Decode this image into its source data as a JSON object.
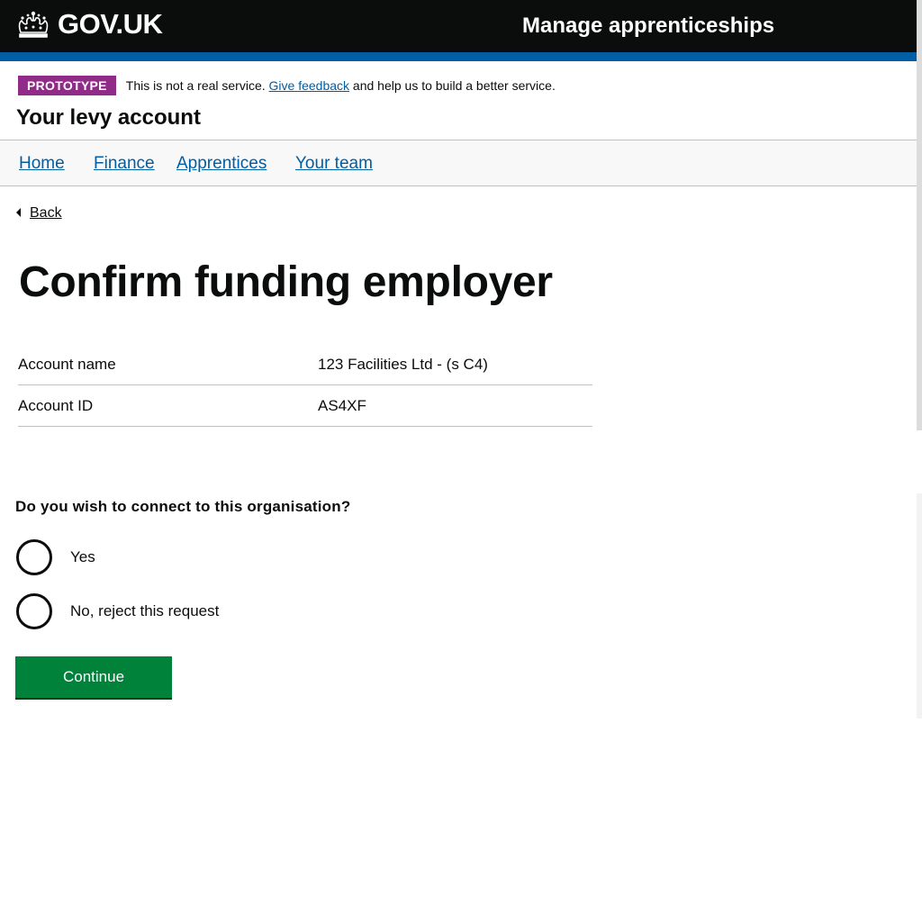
{
  "header": {
    "logo_text": "GOV.UK",
    "service_name": "Manage apprenticeships",
    "bg_color": "#0b0c0c",
    "bar_color": "#005ea5"
  },
  "phase_banner": {
    "tag": "PROTOTYPE",
    "text_before": "This is not a real service.",
    "link_text": "Give feedback",
    "text_after": "and help us to build a better service.",
    "tag_color": "#912b88"
  },
  "account_title": "Your levy account",
  "nav": {
    "items": [
      {
        "label": "Home"
      },
      {
        "label": "Finance"
      },
      {
        "label": "Apprentices"
      },
      {
        "label": "Your team"
      }
    ]
  },
  "back_link": "Back",
  "page_title": "Confirm funding employer",
  "summary": {
    "rows": [
      {
        "key": "Account name",
        "value": "123 Facilities Ltd - (s C4)"
      },
      {
        "key": "Account ID",
        "value": "AS4XF"
      }
    ]
  },
  "question": "Do you wish to connect to this organisation?",
  "options": [
    {
      "label": "Yes"
    },
    {
      "label": "No, reject this request"
    }
  ],
  "continue_button": "Continue",
  "button_color": "#00823b"
}
